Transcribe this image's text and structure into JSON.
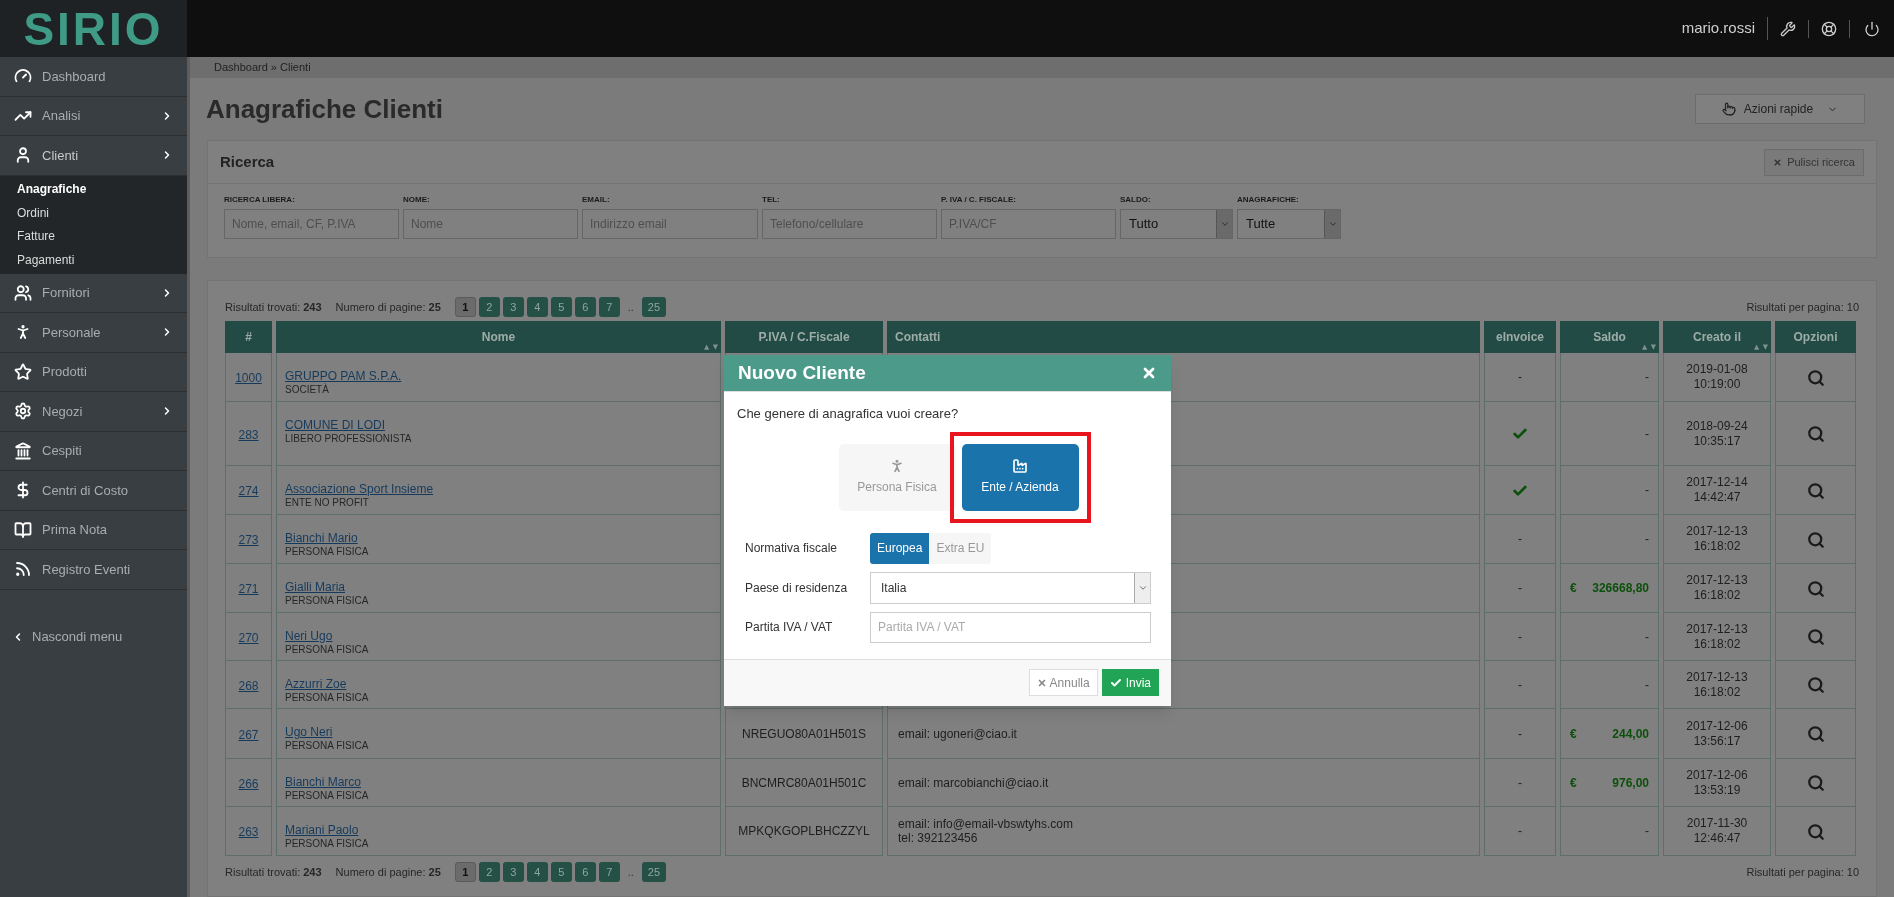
{
  "header": {
    "logo": "SIRIO",
    "user": "mario.rossi"
  },
  "sidebar": {
    "items": [
      {
        "label": "Dashboard",
        "has_submenu": false,
        "expanded": false
      },
      {
        "label": "Analisi",
        "has_submenu": true,
        "expanded": false
      },
      {
        "label": "Clienti",
        "has_submenu": true,
        "expanded": true,
        "children": [
          {
            "label": "Anagrafiche",
            "selected": true
          },
          {
            "label": "Ordini",
            "selected": false
          },
          {
            "label": "Fatture",
            "selected": false
          },
          {
            "label": "Pagamenti",
            "selected": false
          }
        ]
      },
      {
        "label": "Fornitori",
        "has_submenu": true,
        "expanded": false
      },
      {
        "label": "Personale",
        "has_submenu": true,
        "expanded": false
      },
      {
        "label": "Prodotti",
        "has_submenu": false,
        "expanded": false
      },
      {
        "label": "Negozi",
        "has_submenu": true,
        "expanded": false
      },
      {
        "label": "Cespiti",
        "has_submenu": false,
        "expanded": false
      },
      {
        "label": "Centri di Costo",
        "has_submenu": false,
        "expanded": false
      },
      {
        "label": "Prima Nota",
        "has_submenu": false,
        "expanded": false
      },
      {
        "label": "Registro Eventi",
        "has_submenu": false,
        "expanded": false
      }
    ],
    "collapse": "Nascondi menu"
  },
  "breadcrumb": "Dashboard » Clienti",
  "page_title": "Anagrafiche Clienti",
  "quick_actions": "Azioni rapide",
  "search": {
    "title": "Ricerca",
    "clear": "Pulisci ricerca",
    "fields": [
      {
        "label": "RICERCA LIBERA:",
        "kind": "text",
        "placeholder": "Nome, email, CF, P.IVA"
      },
      {
        "label": "NOME:",
        "kind": "text",
        "placeholder": "Nome"
      },
      {
        "label": "EMAIL:",
        "kind": "text",
        "placeholder": "Indirizzo email"
      },
      {
        "label": "TEL:",
        "kind": "text",
        "placeholder": "Telefono/cellulare"
      },
      {
        "label": "P. IVA / C. FISCALE:",
        "kind": "text",
        "placeholder": "P.IVA/CF"
      },
      {
        "label": "SALDO:",
        "kind": "select",
        "value": "Tutto"
      },
      {
        "label": "ANAGRAFICHE:",
        "kind": "select",
        "value": "Tutte"
      }
    ]
  },
  "pager_top": {
    "found": "Risultati trovati: **243**",
    "pages": "Numero di pagine: **25**",
    "per_page": "Risultati per pagina: 10",
    "buttons": [
      {
        "label": "1",
        "kind": "page",
        "selected": true
      },
      {
        "label": "2",
        "kind": "page",
        "selected": false
      },
      {
        "label": "3",
        "kind": "page",
        "selected": false
      },
      {
        "label": "4",
        "kind": "page",
        "selected": false
      },
      {
        "label": "5",
        "kind": "page",
        "selected": false
      },
      {
        "label": "6",
        "kind": "page",
        "selected": false
      },
      {
        "label": "7",
        "kind": "page",
        "selected": false
      },
      {
        "label": "..",
        "kind": "gap"
      },
      {
        "label": "25",
        "kind": "page",
        "selected": false
      }
    ]
  },
  "table": {
    "columns": [
      {
        "label": "#",
        "sortable": false
      },
      {
        "label": "Nome",
        "sortable": true
      },
      {
        "label": "P.IVA / C.Fiscale",
        "sortable": false
      },
      {
        "label": "Contatti",
        "sortable": false
      },
      {
        "label": "eInvoice",
        "sortable": false
      },
      {
        "label": "Saldo",
        "sortable": true
      },
      {
        "label": "Creato il",
        "sortable": true
      },
      {
        "label": "Opzioni",
        "sortable": false
      }
    ],
    "rows": [
      {
        "id": "1000",
        "name": "GRUPPO PAM S.P.A.",
        "type": "SOCIETÀ",
        "einvoice": false,
        "einvoice_text": "-",
        "saldo": "-",
        "date": "2019-01-08",
        "time": "10:19:00"
      },
      {
        "id": "283",
        "name": "COMUNE DI LODI",
        "type": "LIBERO PROFESSIONISTA",
        "einvoice": true,
        "saldo": "-",
        "date": "2018-09-24",
        "time": "10:35:17"
      },
      {
        "id": "274",
        "name": "Associazione Sport Insieme",
        "type": "ENTE NO PROFIT",
        "einvoice": true,
        "saldo": "-",
        "date": "2017-12-14",
        "time": "14:42:47"
      },
      {
        "id": "273",
        "name": "Bianchi Mario",
        "type": "PERSONA FISICA",
        "einvoice": false,
        "einvoice_text": "-",
        "saldo": "-",
        "date": "2017-12-13",
        "time": "16:18:02"
      },
      {
        "id": "271",
        "name": "Gialli Maria",
        "type": "PERSONA FISICA",
        "einvoice": false,
        "einvoice_text": "-",
        "currency": "€",
        "saldo": "326668,80",
        "date": "2017-12-13",
        "time": "16:18:02"
      },
      {
        "id": "270",
        "name": "Neri Ugo",
        "type": "PERSONA FISICA",
        "einvoice": false,
        "einvoice_text": "-",
        "saldo": "-",
        "date": "2017-12-13",
        "time": "16:18:02"
      },
      {
        "id": "268",
        "name": "Azzurri Zoe",
        "type": "PERSONA FISICA",
        "einvoice": false,
        "einvoice_text": "-",
        "saldo": "-",
        "date": "2017-12-13",
        "time": "16:18:02"
      },
      {
        "id": "267",
        "name": "Ugo Neri",
        "type": "PERSONA FISICA",
        "piva": "NREGUO80A01H501S",
        "contacts": [
          "email: ugoneri@ciao.it"
        ],
        "einvoice": false,
        "einvoice_text": "-",
        "currency": "€",
        "saldo": "244,00",
        "date": "2017-12-06",
        "time": "13:56:17"
      },
      {
        "id": "266",
        "name": "Bianchi Marco",
        "type": "PERSONA FISICA",
        "piva": "BNCMRC80A01H501C",
        "contacts": [
          "email: marcobianchi@ciao.it"
        ],
        "einvoice": false,
        "einvoice_text": "-",
        "currency": "€",
        "saldo": "976,00",
        "date": "2017-12-06",
        "time": "13:53:19"
      },
      {
        "id": "263",
        "name": "Mariani Paolo",
        "type": "PERSONA FISICA",
        "piva": "MPKQKGOPLBHCZZYL",
        "contacts": [
          "email: info@email-vbswtyhs.com",
          "tel: 392123456"
        ],
        "einvoice": false,
        "einvoice_text": "-",
        "saldo": "-",
        "date": "2017-11-30",
        "time": "12:46:47"
      }
    ]
  },
  "pager_bottom": {
    "found": "Risultati trovati: **243**",
    "pages": "Numero di pagine: **25**",
    "per_page": "Risultati per pagina: 10",
    "buttons": [
      {
        "label": "1",
        "kind": "page",
        "selected": true
      },
      {
        "label": "2",
        "kind": "page",
        "selected": false
      },
      {
        "label": "3",
        "kind": "page",
        "selected": false
      },
      {
        "label": "4",
        "kind": "page",
        "selected": false
      },
      {
        "label": "5",
        "kind": "page",
        "selected": false
      },
      {
        "label": "6",
        "kind": "page",
        "selected": false
      },
      {
        "label": "7",
        "kind": "page",
        "selected": false
      },
      {
        "label": "..",
        "kind": "gap"
      },
      {
        "label": "25",
        "kind": "page",
        "selected": false
      }
    ]
  },
  "modal": {
    "title": "Nuovo Cliente",
    "question": "Che genere di anagrafica vuoi creare?",
    "choices": [
      {
        "label": "Persona Fisica",
        "selected": false,
        "highlighted": false
      },
      {
        "label": "Ente / Azienda",
        "selected": true,
        "highlighted": true
      }
    ],
    "fields": [
      {
        "label": "Normativa fiscale",
        "kind": "segmented",
        "options": [
          {
            "label": "Europea",
            "selected": true
          },
          {
            "label": "Extra EU",
            "selected": false
          }
        ]
      },
      {
        "label": "Paese di residenza",
        "kind": "select",
        "value": "Italia"
      },
      {
        "label": "Partita IVA / VAT",
        "kind": "text",
        "placeholder": "Partita IVA / VAT"
      }
    ],
    "cancel": "Annulla",
    "submit": "Invia"
  }
}
